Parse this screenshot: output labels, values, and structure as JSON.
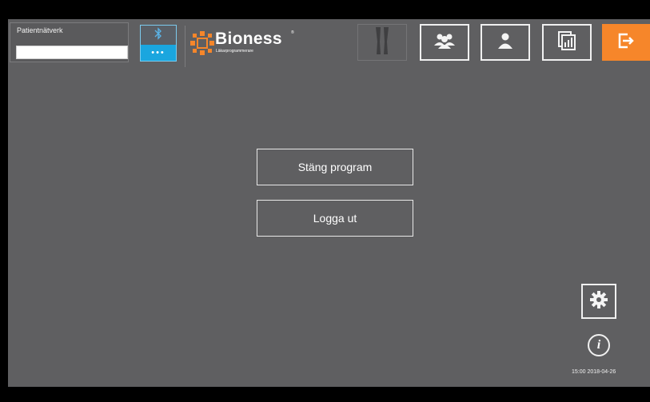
{
  "network": {
    "label": "Patientnätverk",
    "value": "",
    "placeholder": ""
  },
  "bluetooth": {
    "icon": "bluetooth-icon",
    "status_dots": "•••"
  },
  "brand": {
    "name": "Bioness",
    "subtitle": "Läkarprogrammerare",
    "trademark": "®",
    "accent": "#f6862a"
  },
  "toolbar": {
    "buttons": [
      {
        "icon": "legs-icon",
        "enabled": false
      },
      {
        "icon": "group-icon",
        "enabled": true
      },
      {
        "icon": "user-icon",
        "enabled": true
      },
      {
        "icon": "report-icon",
        "enabled": true
      },
      {
        "icon": "exit-icon",
        "enabled": true,
        "color": "#f6862a"
      }
    ]
  },
  "menu": {
    "close_program": "Stäng program",
    "log_out": "Logga ut"
  },
  "footer": {
    "settings_icon": "gear-icon",
    "info_icon": "info-icon",
    "info_glyph": "i",
    "timestamp": "15:00 2018-04-26"
  }
}
